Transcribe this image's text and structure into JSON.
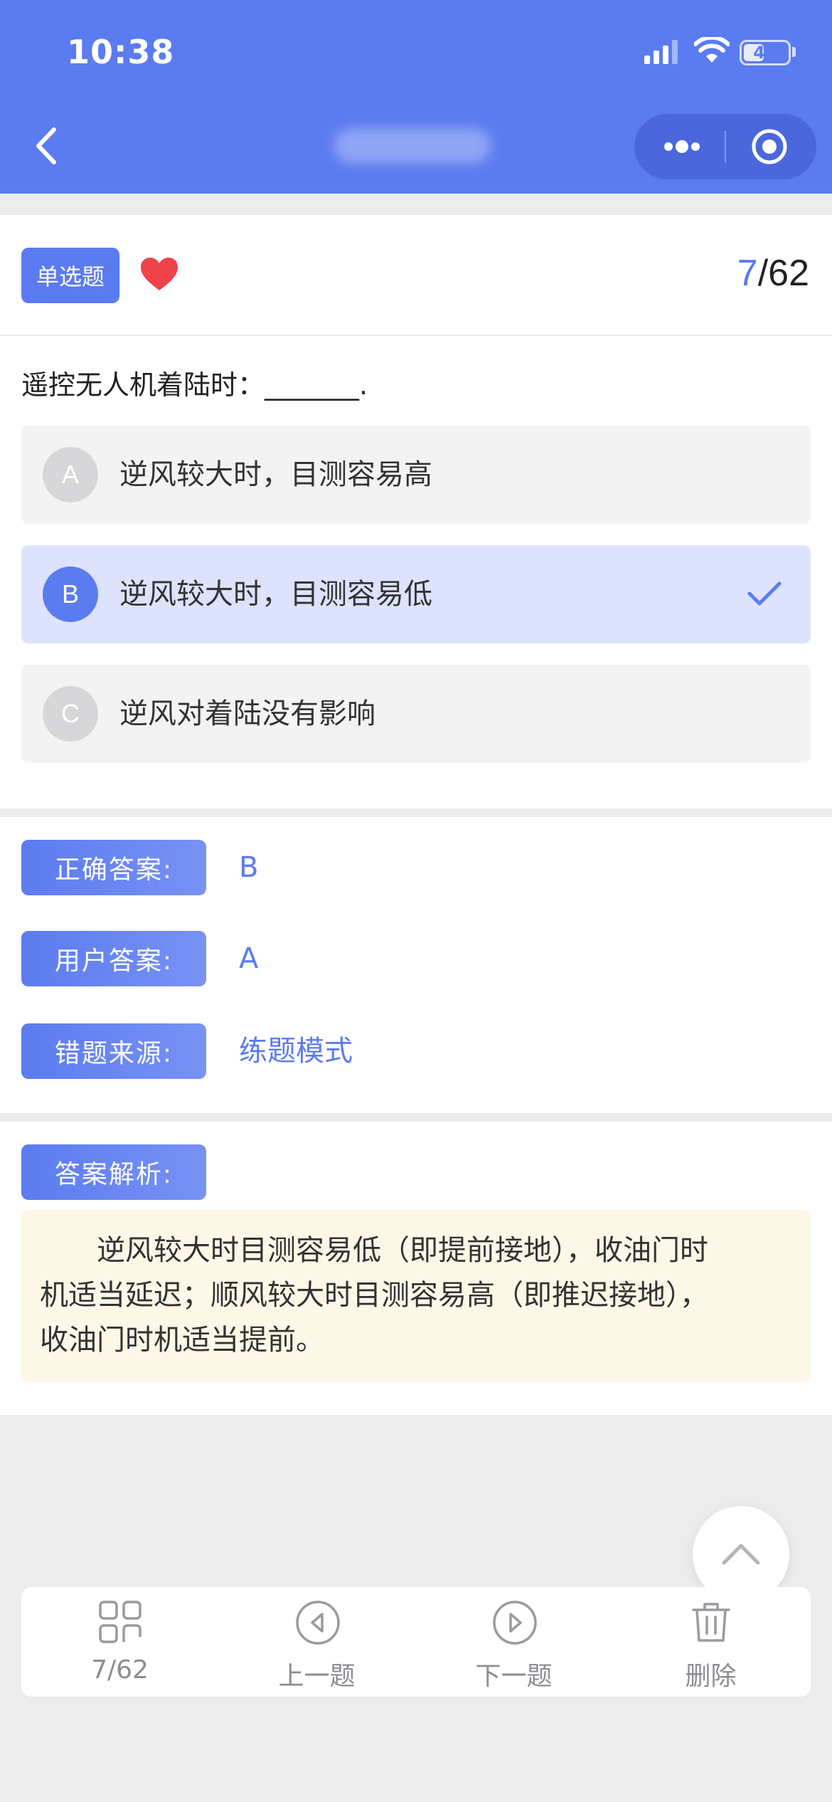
{
  "status_bar": {
    "time": "10:38",
    "battery": "47",
    "battery_level": 0.47,
    "icons": [
      "signal-icon",
      "wifi-icon",
      "battery-icon"
    ]
  },
  "nav": {
    "icons": [
      "back-arrow-icon",
      "more-dots-icon",
      "target-circle-icon"
    ]
  },
  "question": {
    "type": "单选题",
    "current": "7",
    "sep_total": "/62",
    "text": "遥控无人机着陆时：_______.",
    "options": [
      {
        "letter": "A",
        "text": "逆风较大时，目测容易高",
        "selected": false
      },
      {
        "letter": "B",
        "text": "逆风较大时，目测容易低",
        "selected": true
      },
      {
        "letter": "C",
        "text": "逆风对着陆没有影响",
        "selected": false
      }
    ]
  },
  "answers": {
    "correct_label": "正确答案:",
    "correct_value": "B",
    "user_label": "用户答案:",
    "user_value": "A",
    "source_label": "错题来源:",
    "source_value": "练题模式"
  },
  "analysis": {
    "label": "答案解析:",
    "text": "逆风较大时目测容易低（即提前接地），收油门时机适当延迟；顺风较大时目测容易高（即推迟接地），收油门时机适当提前。"
  },
  "bottom_bar": {
    "items": [
      {
        "label": "7/62",
        "icon": "grid-icon"
      },
      {
        "label": "上一题",
        "icon": "previous-circle-icon"
      },
      {
        "label": "下一题",
        "icon": "next-circle-icon"
      },
      {
        "label": "删除",
        "icon": "trash-icon"
      }
    ]
  },
  "colors": {
    "accent": "#5b7bf0",
    "heart": "#f0424b",
    "analysis_bg": "#fdf7e7",
    "selected_bg": "#dde3fc"
  }
}
